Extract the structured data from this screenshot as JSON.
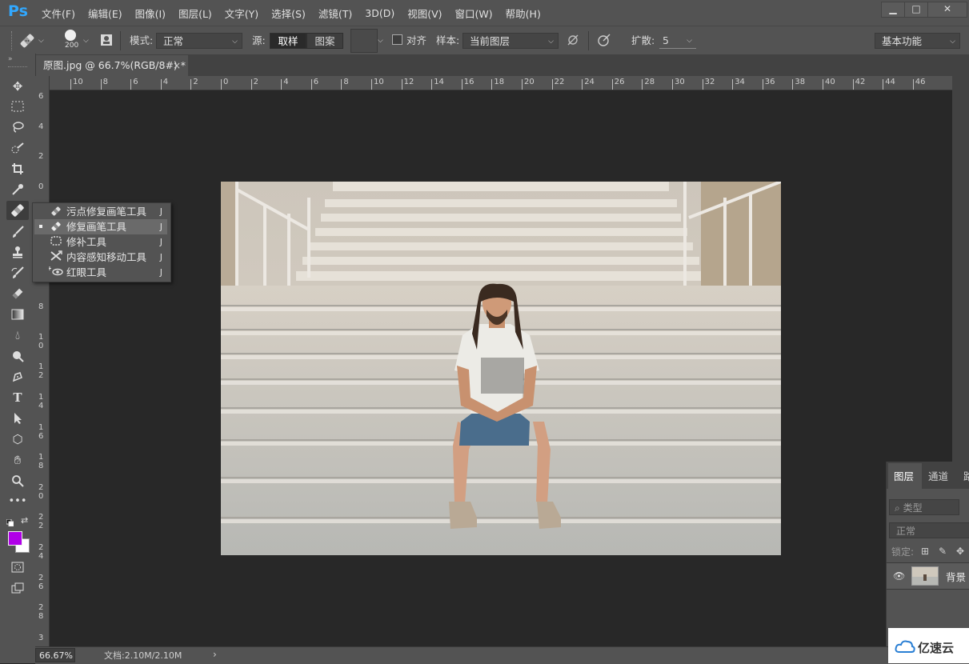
{
  "app": {
    "logo": "Ps"
  },
  "menu": [
    "文件(F)",
    "编辑(E)",
    "图像(I)",
    "图层(L)",
    "文字(Y)",
    "选择(S)",
    "滤镜(T)",
    "3D(D)",
    "视图(V)",
    "窗口(W)",
    "帮助(H)"
  ],
  "window_buttons": {
    "minimize": "▁",
    "maximize": "□",
    "close": "✕"
  },
  "options": {
    "brush_size": "200",
    "mode_label": "模式:",
    "mode_value": "正常",
    "source_label": "源:",
    "source_sample": "取样",
    "source_pattern": "图案",
    "align_label": "对齐",
    "sample_label": "样本:",
    "sample_value": "当前图层",
    "diffusion_label": "扩散:",
    "diffusion_value": "5",
    "workspace": "基本功能"
  },
  "document_tab": {
    "title": "原图.jpg @ 66.7%(RGB/8#) *",
    "close": "×"
  },
  "ruler_top": [
    "10",
    "8",
    "6",
    "4",
    "2",
    "0",
    "2",
    "4",
    "6",
    "8",
    "10",
    "12",
    "14",
    "16",
    "18",
    "20",
    "22",
    "24",
    "26",
    "28",
    "30",
    "32",
    "34",
    "36",
    "38",
    "40",
    "42",
    "44",
    "46"
  ],
  "ruler_left": [
    "6",
    "4",
    "2",
    "0",
    "2",
    "4",
    "6",
    "8",
    "1 0",
    "1 2",
    "1 4",
    "1 6",
    "1 8",
    "2 0",
    "2 2",
    "2 4",
    "2 6",
    "2 8",
    "3"
  ],
  "flyout": [
    {
      "label": "污点修复画笔工具",
      "key": "J",
      "icon": "spot-healing-brush-icon",
      "selected": false
    },
    {
      "label": "修复画笔工具",
      "key": "J",
      "icon": "healing-brush-icon",
      "selected": true
    },
    {
      "label": "修补工具",
      "key": "J",
      "icon": "patch-icon",
      "selected": false
    },
    {
      "label": "内容感知移动工具",
      "key": "J",
      "icon": "content-aware-move-icon",
      "selected": false
    },
    {
      "label": "红眼工具",
      "key": "J",
      "icon": "red-eye-icon",
      "selected": false
    }
  ],
  "colors": {
    "foreground": "#b000e8",
    "background": "#ffffff"
  },
  "layers_panel": {
    "tabs": [
      "图层",
      "通道",
      "路"
    ],
    "filter_placeholder": "类型",
    "blend_mode": "正常",
    "lock_label": "锁定:",
    "layer_name": "背景"
  },
  "status": {
    "zoom": "66.67%",
    "doc_info": "文档:2.10M/2.10M",
    "arrow": "›"
  },
  "watermark": {
    "text": "亿速云"
  }
}
